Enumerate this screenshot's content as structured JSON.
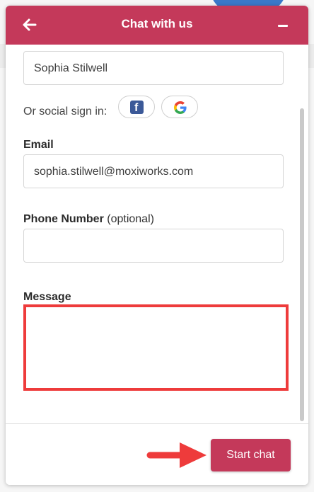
{
  "header": {
    "title": "Chat with us",
    "back_icon": "arrow-left-icon",
    "minimize_icon": "minus-icon",
    "color": "#c4395a"
  },
  "form": {
    "name_value": "Sophia Stilwell",
    "social_label": "Or social sign in:",
    "social_buttons": [
      "facebook-icon",
      "google-icon"
    ],
    "email_label": "Email",
    "email_value": "sophia.stilwell@moxiworks.com",
    "phone_label": "Phone Number",
    "phone_optional": "(optional)",
    "phone_value": "",
    "message_label": "Message",
    "message_value": "",
    "highlight_color": "#ee3b3b"
  },
  "footer": {
    "start_button": "Start chat",
    "arrow_icon": "arrow-right-icon",
    "arrow_color": "#ee3b3b"
  }
}
